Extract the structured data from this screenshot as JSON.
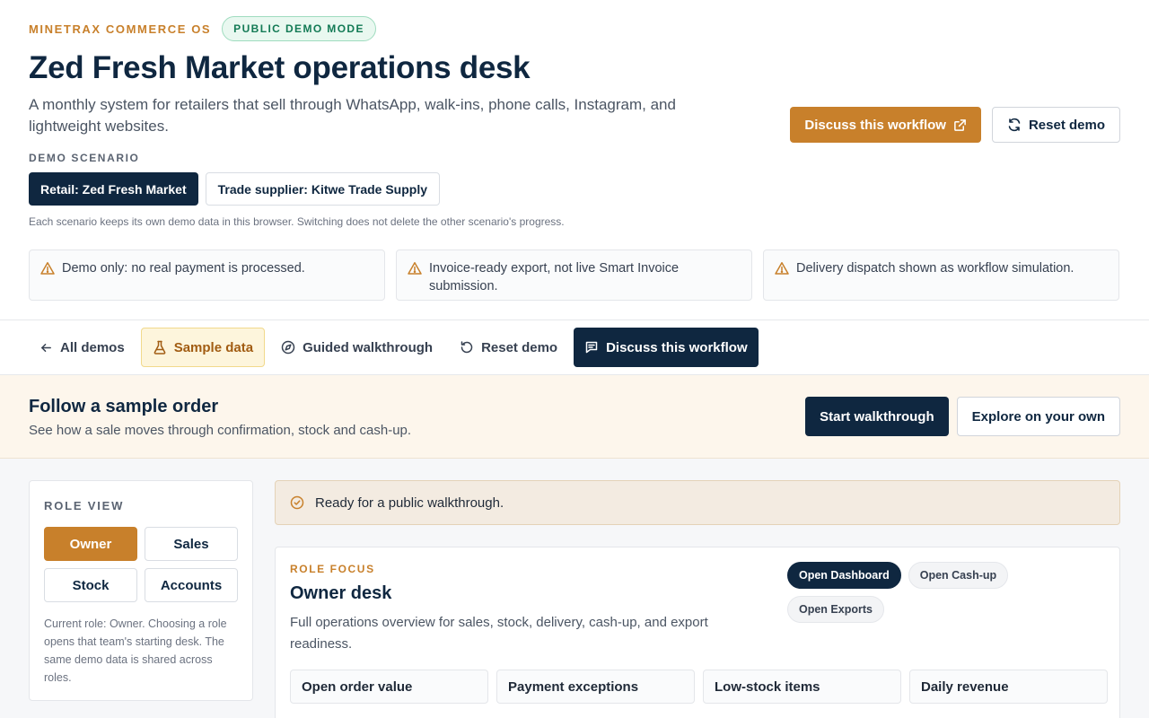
{
  "header": {
    "brand": "MINETRAX COMMERCE OS",
    "mode_badge": "PUBLIC DEMO MODE",
    "title": "Zed Fresh Market operations desk",
    "subtitle": "A monthly system for retailers that sell through WhatsApp, walk-ins, phone calls, Instagram, and lightweight websites.",
    "scenario_label": "DEMO SCENARIO",
    "scenarios": [
      {
        "label": "Retail: Zed Fresh Market",
        "active": true
      },
      {
        "label": "Trade supplier: Kitwe Trade Supply",
        "active": false
      }
    ],
    "scenario_note": "Each scenario keeps its own demo data in this browser. Switching does not delete the other scenario's progress.",
    "discuss_label": "Discuss this workflow",
    "reset_label": "Reset demo",
    "notices": [
      "Demo only: no real payment is processed.",
      "Invoice-ready export, not live Smart Invoice submission.",
      "Delivery dispatch shown as workflow simulation."
    ]
  },
  "toolbar": {
    "all_demos": "All demos",
    "sample_data": "Sample data",
    "guided": "Guided walkthrough",
    "reset": "Reset demo",
    "discuss": "Discuss this workflow"
  },
  "walkthrough": {
    "title": "Follow a sample order",
    "subtitle": "See how a sale moves through confirmation, stock and cash-up.",
    "start": "Start walkthrough",
    "explore": "Explore on your own"
  },
  "role_view": {
    "label": "ROLE VIEW",
    "roles": [
      {
        "label": "Owner",
        "active": true
      },
      {
        "label": "Sales",
        "active": false
      },
      {
        "label": "Stock",
        "active": false
      },
      {
        "label": "Accounts",
        "active": false
      }
    ],
    "note": "Current role: Owner. Choosing a role opens that team's starting desk. The same demo data is shared across roles."
  },
  "ready_message": "Ready for a public walkthrough.",
  "role_focus": {
    "label": "ROLE FOCUS",
    "title": "Owner desk",
    "description": "Full operations overview for sales, stock, delivery, cash-up, and export readiness.",
    "pills": [
      {
        "label": "Open Dashboard",
        "active": true
      },
      {
        "label": "Open Cash-up",
        "active": false
      },
      {
        "label": "Open Exports",
        "active": false
      }
    ],
    "metrics": [
      "Open order value",
      "Payment exceptions",
      "Low-stock items",
      "Daily revenue"
    ]
  },
  "colors": {
    "accent": "#c8802b",
    "navy": "#0f2740",
    "success": "#137a55"
  }
}
